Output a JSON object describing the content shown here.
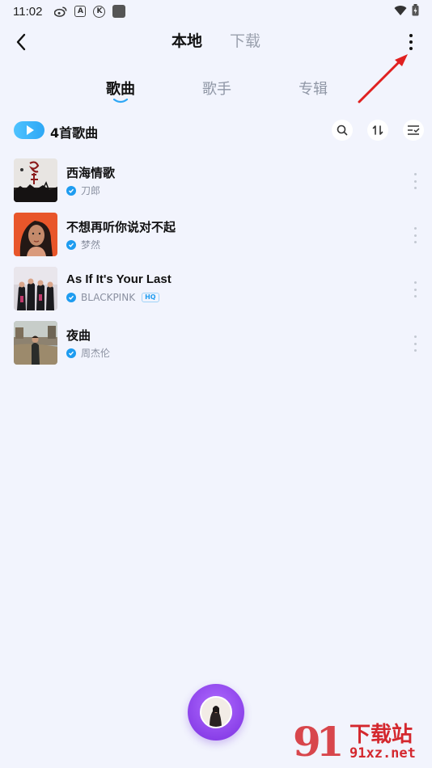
{
  "status_bar": {
    "time": "11:02",
    "icons": [
      "weibo-icon",
      "a-box-icon",
      "k-circle-icon",
      "app-square-icon"
    ],
    "a_label": "A",
    "k_label": "K",
    "right_icons": [
      "wifi-icon",
      "battery-icon"
    ]
  },
  "header": {
    "tabs": [
      {
        "label": "本地",
        "active": true
      },
      {
        "label": "下载",
        "active": false
      }
    ]
  },
  "sub_tabs": [
    {
      "label": "歌曲",
      "active": true
    },
    {
      "label": "歌手",
      "active": false
    },
    {
      "label": "专辑",
      "active": false
    }
  ],
  "toolbar": {
    "song_count": "4首歌曲",
    "icons": [
      "search-icon",
      "sort-icon",
      "multi-select-icon"
    ]
  },
  "songs": [
    {
      "title": "西海情歌",
      "artist": "刀郎",
      "hq": ""
    },
    {
      "title": "不想再听你说对不起",
      "artist": "梦然",
      "hq": ""
    },
    {
      "title": "As If It's Your Last",
      "artist": "BLACKPINK",
      "hq": "HQ"
    },
    {
      "title": "夜曲",
      "artist": "周杰伦",
      "hq": ""
    }
  ],
  "watermark": {
    "logo": "91",
    "title": "下载站",
    "site": "91xz.net"
  },
  "colors": {
    "background": "#f2f4fd",
    "accent": "#1e9cf0",
    "player": "#8a3df0",
    "annotation": "#e02020"
  }
}
